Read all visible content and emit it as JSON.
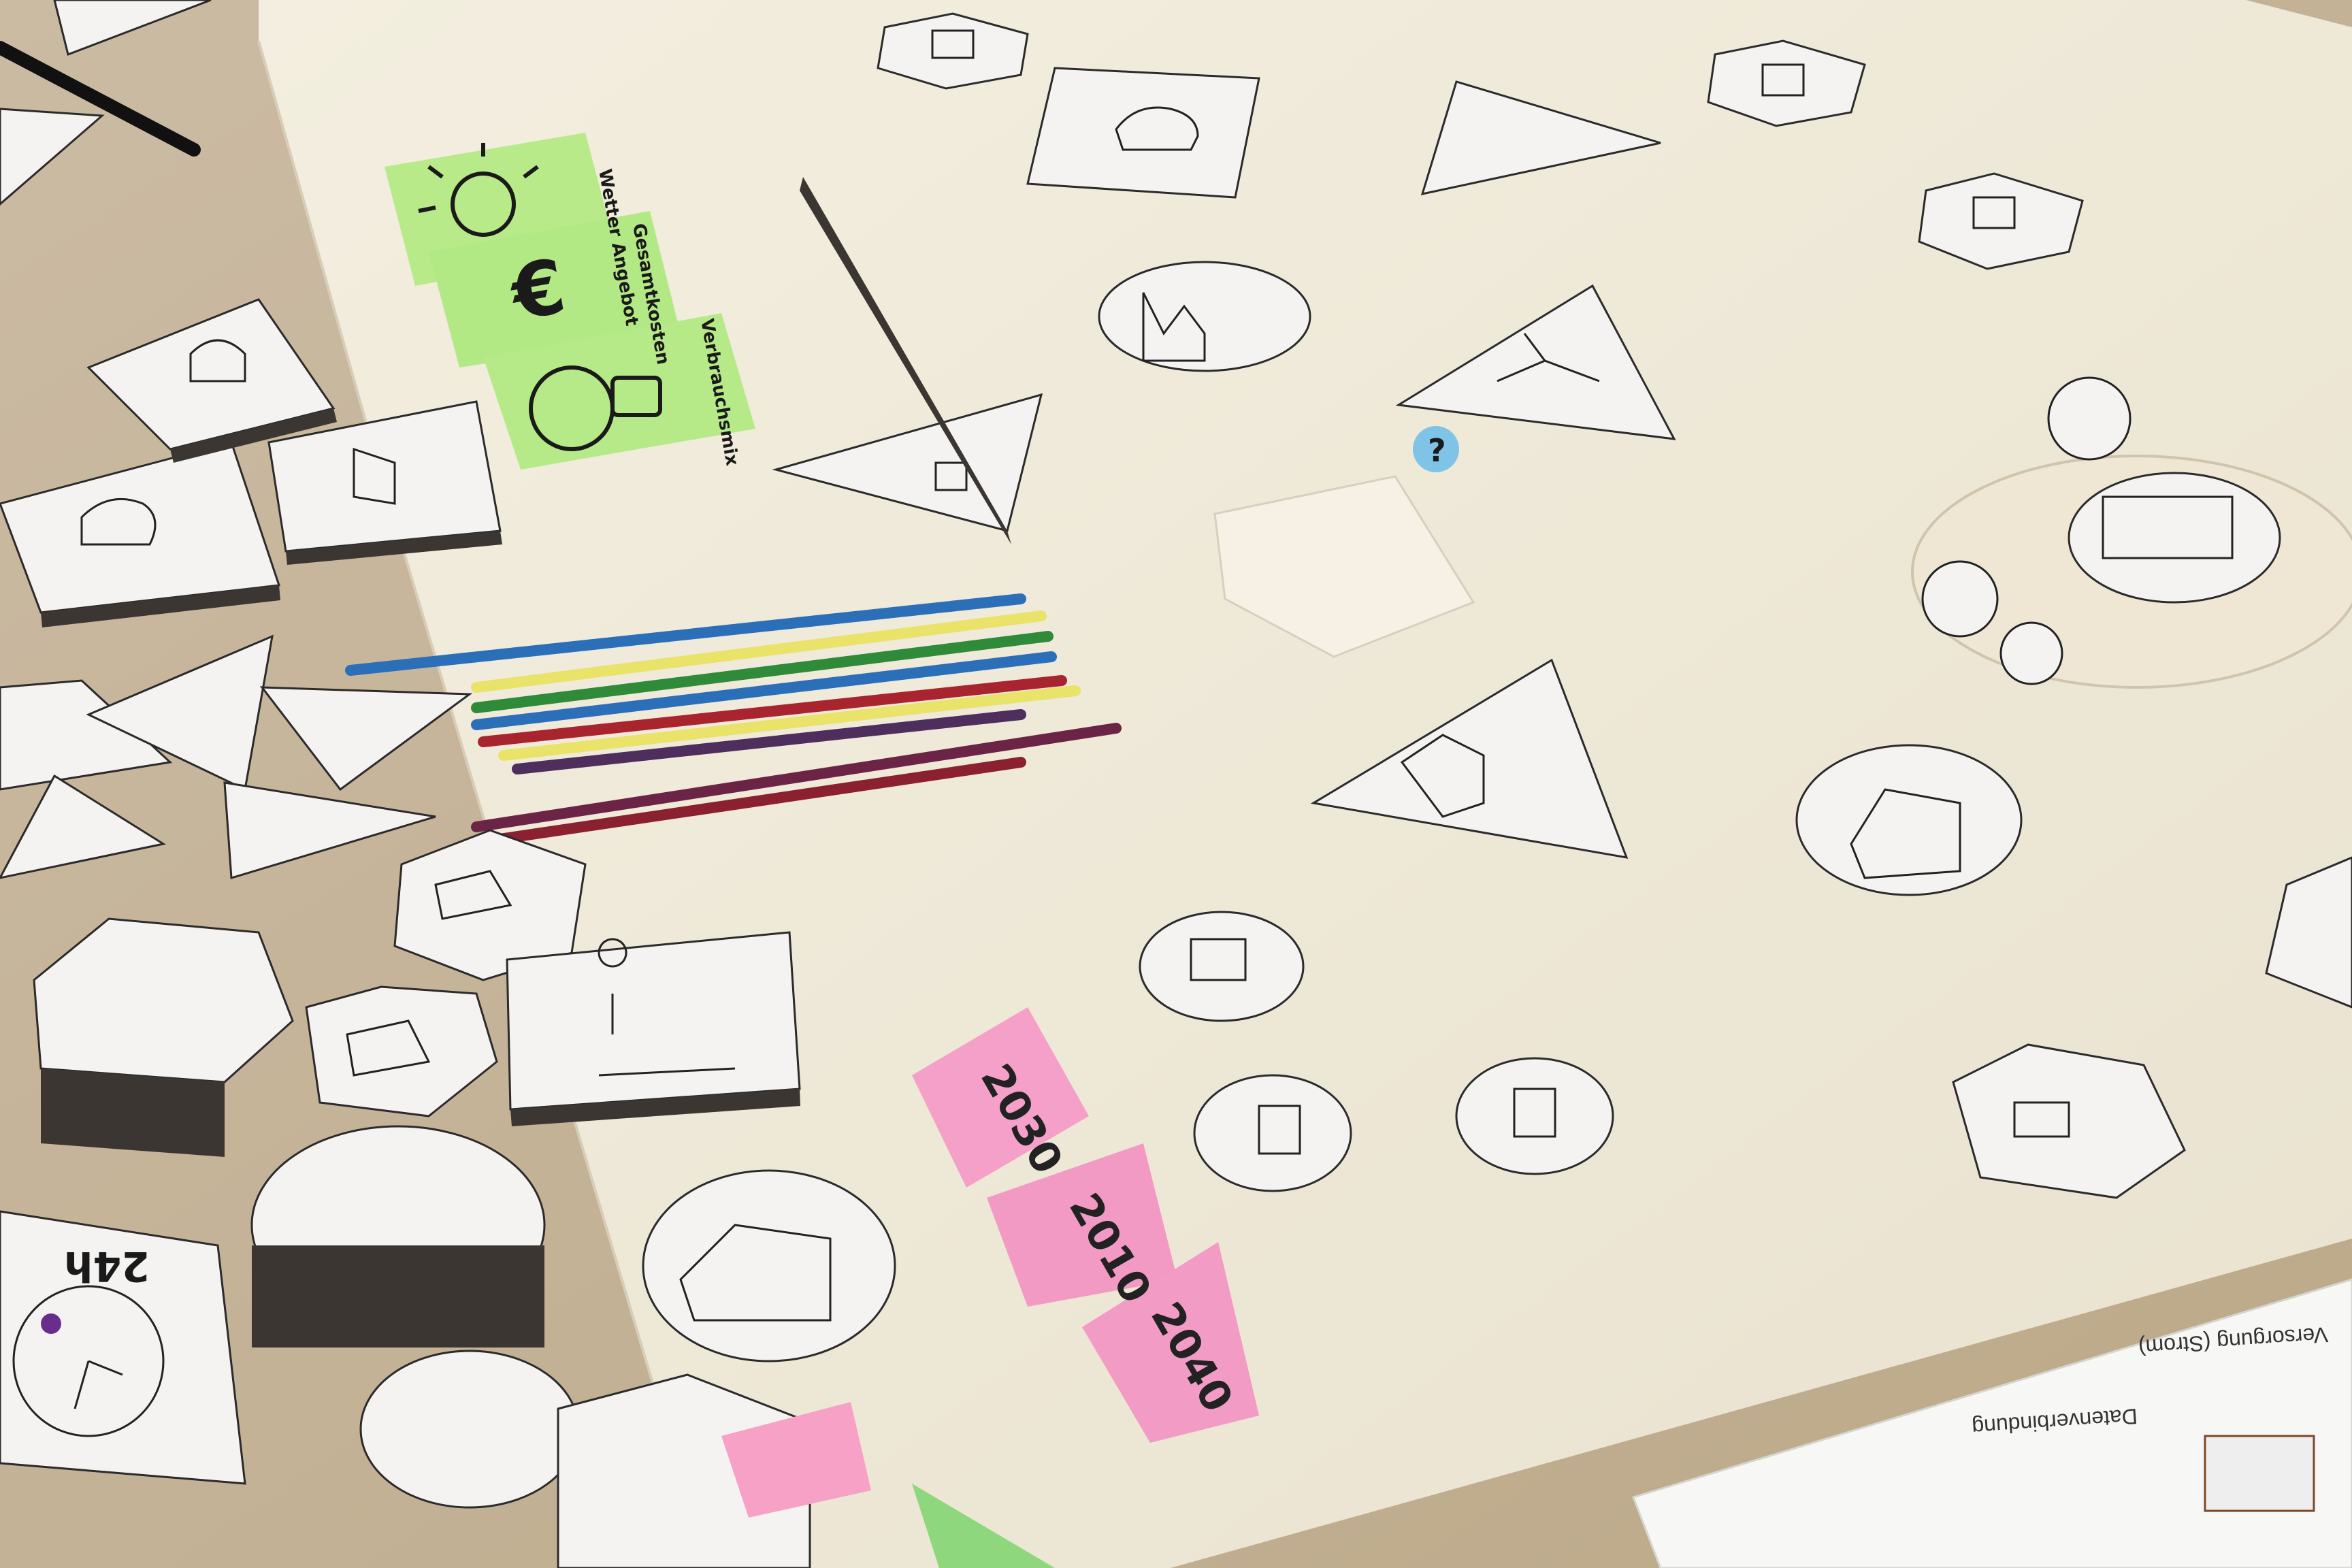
{
  "scene": {
    "description_free": true,
    "colors": {
      "table": "#c9b9a2",
      "paper": "#efe9d9",
      "card": "#f4f3f1",
      "cardboard": "#3b3632",
      "sticky_green": "#b6ea88",
      "sticky_pink": "#f39ac4",
      "dot_blue": "#7fc4e6",
      "pencil_blue": "#2a6fb8",
      "pencil_yellow": "#e9e36a",
      "pencil_red": "#a8242e",
      "pencil_purple": "#6b2445",
      "pencil_green": "#2f8a3a"
    }
  },
  "sticky_notes": {
    "green": [
      {
        "text": "Wetter Angebot"
      },
      {
        "text": "Gesamtkosten"
      },
      {
        "text": "Verbrauchsmix"
      }
    ],
    "pink": [
      {
        "text": "2030"
      },
      {
        "text": "2010"
      },
      {
        "text": "2040"
      }
    ]
  },
  "blue_dot": {
    "text": "?"
  },
  "clock_card": {
    "text": "24h"
  },
  "printout": {
    "lines": [
      {
        "text": "Datenverbindung"
      },
      {
        "text": "Versorgung (Strom)"
      }
    ]
  },
  "tile_icons": [
    "chip-icon",
    "car-icon",
    "house-icon",
    "factory-icon",
    "turbine-icon",
    "washer-icon",
    "stove-icon",
    "appliance-icon",
    "hydro-icon",
    "plant-icon"
  ]
}
